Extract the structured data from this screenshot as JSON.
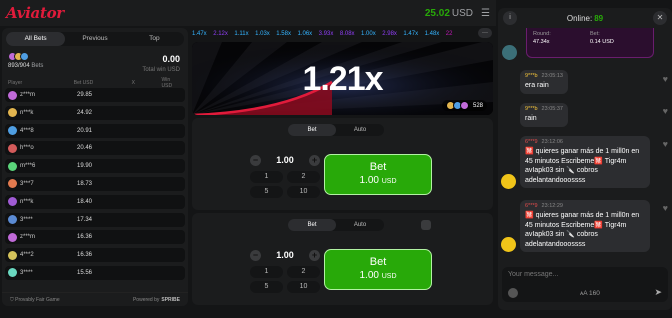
{
  "header": {
    "logo": "Aviator",
    "balance": "25.02",
    "currency": "USD"
  },
  "left": {
    "tabs": [
      {
        "label": "All Bets"
      },
      {
        "label": "Previous"
      },
      {
        "label": "Top"
      }
    ],
    "bets_count": "893/904",
    "bets_label": "Bets",
    "total_win": "0.00",
    "total_win_label": "Total win USD",
    "headers": {
      "player": "Player",
      "bet": "Bet USD",
      "x": "X",
      "win": "Win USD"
    },
    "rows": [
      {
        "name": "z***m",
        "bet": "29.85",
        "color": "#c06ad8"
      },
      {
        "name": "n***k",
        "bet": "24.92",
        "color": "#e2b54f"
      },
      {
        "name": "4***8",
        "bet": "20.91",
        "color": "#4f9ee2"
      },
      {
        "name": "h***o",
        "bet": "20.46",
        "color": "#d45b5b"
      },
      {
        "name": "m***6",
        "bet": "19.90",
        "color": "#5bd47a"
      },
      {
        "name": "3***7",
        "bet": "18.73",
        "color": "#e27a4f"
      },
      {
        "name": "n***k",
        "bet": "18.40",
        "color": "#a05bd4"
      },
      {
        "name": "3****",
        "bet": "17.34",
        "color": "#5b8bd4"
      },
      {
        "name": "z***m",
        "bet": "16.36",
        "color": "#c06ad8"
      },
      {
        "name": "4***2",
        "bet": "16.36",
        "color": "#d4c35b"
      },
      {
        "name": "3****",
        "bet": "15.56",
        "color": "#6ad8c0"
      }
    ],
    "footer": {
      "fair": "Provably Fair Game",
      "powered": "Powered by",
      "brand": "SPRIBE"
    }
  },
  "history": [
    {
      "v": "1.47x",
      "c": "#34b4ff"
    },
    {
      "v": "2.12x",
      "c": "#913ef8"
    },
    {
      "v": "1.11x",
      "c": "#34b4ff"
    },
    {
      "v": "1.03x",
      "c": "#34b4ff"
    },
    {
      "v": "1.58x",
      "c": "#34b4ff"
    },
    {
      "v": "1.06x",
      "c": "#34b4ff"
    },
    {
      "v": "3.93x",
      "c": "#913ef8"
    },
    {
      "v": "8.08x",
      "c": "#913ef8"
    },
    {
      "v": "1.00x",
      "c": "#34b4ff"
    },
    {
      "v": "2.98x",
      "c": "#913ef8"
    },
    {
      "v": "1.47x",
      "c": "#34b4ff"
    },
    {
      "v": "1.48x",
      "c": "#34b4ff"
    },
    {
      "v": "22",
      "c": "#c017b4"
    }
  ],
  "history_more": "···",
  "game": {
    "multiplier": "1.21x",
    "players": "528"
  },
  "bet_panels": [
    {
      "tabs": [
        "Bet",
        "Auto"
      ],
      "amount": "1.00",
      "quick": [
        "1",
        "2",
        "5",
        "10"
      ],
      "button": "Bet",
      "button_amount": "1.00",
      "button_currency": "USD"
    },
    {
      "tabs": [
        "Bet",
        "Auto"
      ],
      "amount": "1.00",
      "quick": [
        "1",
        "2",
        "5",
        "10"
      ],
      "button": "Bet",
      "button_amount": "1.00",
      "button_currency": "USD"
    }
  ],
  "chat": {
    "online_label": "Online:",
    "online_count": "89",
    "win_card": {
      "round_label": "Round:",
      "round_val": "47.34x",
      "bet_label": "Bet:",
      "bet_val": "0.14 USD"
    },
    "messages": [
      {
        "user": "9***b",
        "time": "23:05:13",
        "text": "era rain"
      },
      {
        "user": "9***b",
        "time": "23:05:37",
        "text": "rain"
      },
      {
        "user": "6***9",
        "time": "23:12:06",
        "text": "🈲 quieres ganar más de 1 mill0n en 45 minutos Escribeme🈲 Tigr4m avIapk03 sin 🔪 cobros adelantandooossss"
      },
      {
        "user": "6***9",
        "time": "23:12:29",
        "text": "🈲 quieres ganar más de 1 mill0n en 45 minutos Escribeme🈲 Tigr4m avIapk03 sin 🔪 cobros adelantandooossss"
      }
    ],
    "input_placeholder": "Your message...",
    "char_count": "160"
  }
}
